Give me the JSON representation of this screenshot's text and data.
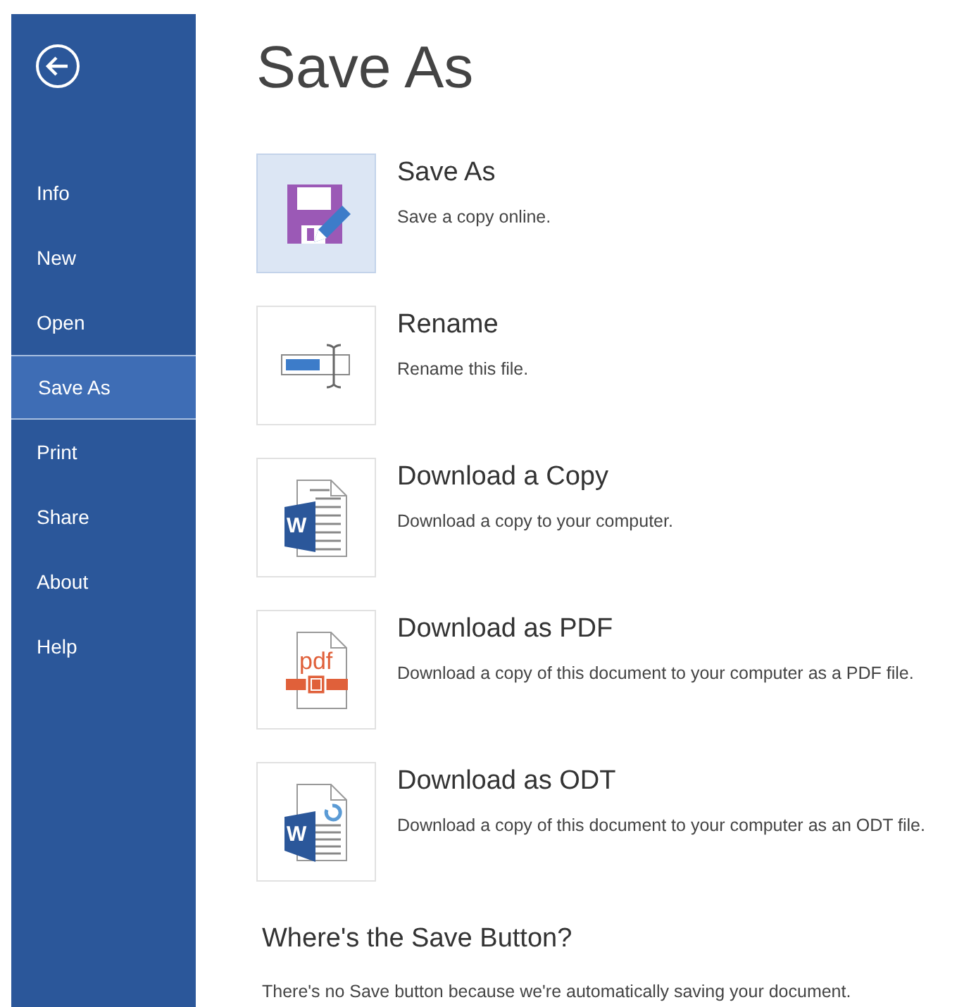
{
  "sidebar": {
    "items": [
      {
        "label": "Info",
        "selected": false
      },
      {
        "label": "New",
        "selected": false
      },
      {
        "label": "Open",
        "selected": false
      },
      {
        "label": "Save As",
        "selected": true
      },
      {
        "label": "Print",
        "selected": false
      },
      {
        "label": "Share",
        "selected": false
      },
      {
        "label": "About",
        "selected": false
      },
      {
        "label": "Help",
        "selected": false
      }
    ]
  },
  "title": "Save As",
  "options": [
    {
      "kind": "save",
      "title": "Save As",
      "description": "Save a copy online.",
      "selected": true
    },
    {
      "kind": "rename",
      "title": "Rename",
      "description": "Rename this file.",
      "selected": false
    },
    {
      "kind": "word",
      "badge": "W",
      "title": "Download a Copy",
      "description": "Download a copy to your computer.",
      "selected": false
    },
    {
      "kind": "pdf",
      "badge": "pdf",
      "title": "Download as PDF",
      "description": "Download a copy of this document to your computer as a PDF file.",
      "selected": false
    },
    {
      "kind": "odt",
      "badge": "W",
      "title": "Download as ODT",
      "description": "Download a copy of this document to your computer as an ODT file.",
      "selected": false
    }
  ],
  "note": {
    "heading": "Where's the Save Button?",
    "text": "There's no Save button because we're automatically saving your document."
  }
}
